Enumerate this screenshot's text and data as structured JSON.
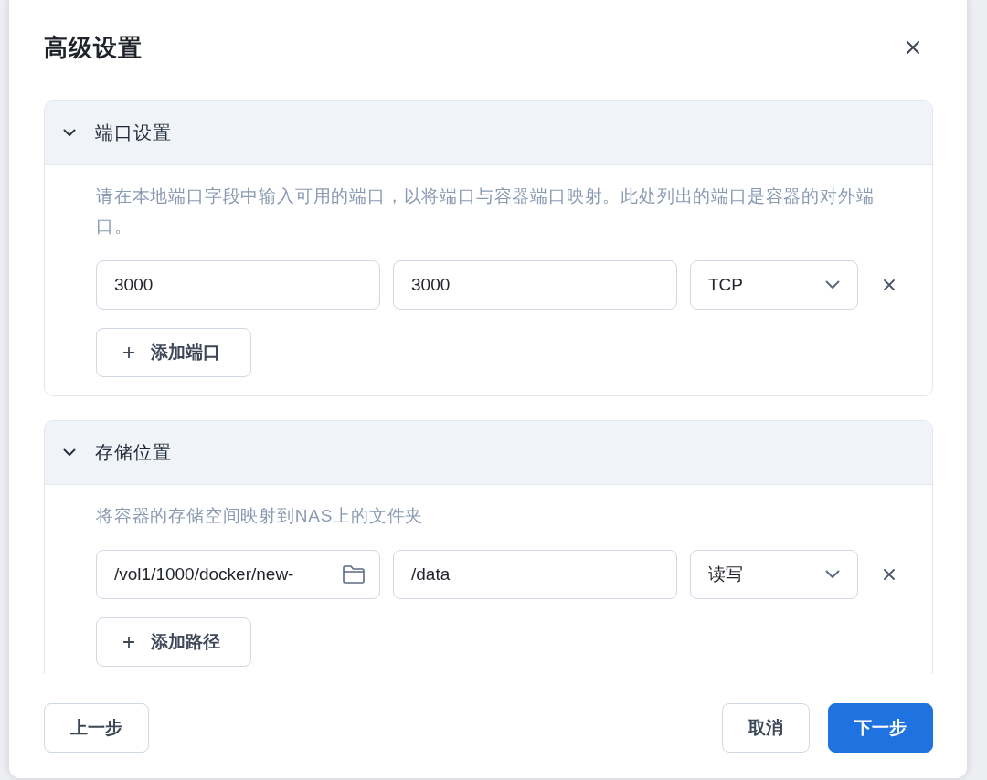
{
  "dialog": {
    "title": "高级设置"
  },
  "sections": [
    {
      "title": "端口设置",
      "expanded": true,
      "description": "请在本地端口字段中输入可用的端口，以将端口与容器端口映射。此处列出的端口是容器的对外端口。",
      "rows": [
        {
          "fields": [
            {
              "kind": "text",
              "value": "3000"
            },
            {
              "kind": "text",
              "value": "3000"
            },
            {
              "kind": "select",
              "value": "TCP"
            }
          ]
        }
      ],
      "add_button": "添加端口"
    },
    {
      "title": "存储位置",
      "expanded": true,
      "description": "将容器的存储空间映射到NAS上的文件夹",
      "rows": [
        {
          "fields": [
            {
              "kind": "folder",
              "value": "/vol1/1000/docker/new-"
            },
            {
              "kind": "text",
              "value": "/data"
            },
            {
              "kind": "select",
              "value": "读写"
            }
          ]
        }
      ],
      "add_button": "添加路径"
    }
  ],
  "footer": {
    "back_button": "上一步",
    "cancel_button": "取消",
    "next_button": "下一步"
  }
}
